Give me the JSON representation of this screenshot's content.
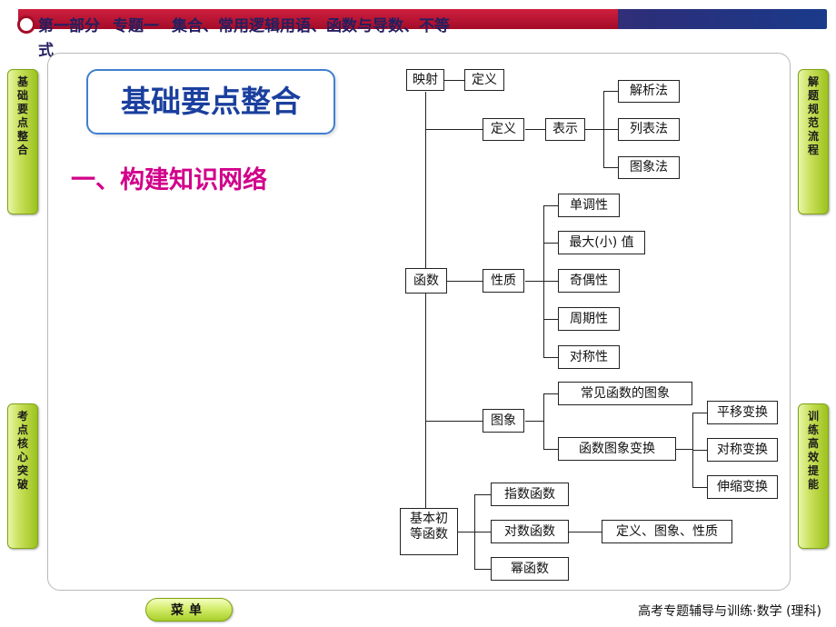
{
  "header": {
    "part": "第一部分",
    "topic": "专题一",
    "title": "集合、常用逻辑用语、函数与导数、不等",
    "title_line2": "式"
  },
  "side_tabs": {
    "left": [
      {
        "name": "basic-points-tab",
        "chars": [
          "基",
          "础",
          "要",
          "点",
          "整",
          "合"
        ]
      },
      {
        "name": "exam-points-tab",
        "chars": [
          "考",
          "点",
          "核",
          "心",
          "突",
          "破"
        ]
      }
    ],
    "right": [
      {
        "name": "solution-standard-tab",
        "chars": [
          "解",
          "题",
          "规",
          "范",
          "流",
          "程"
        ]
      },
      {
        "name": "training-tab",
        "chars": [
          "训",
          "练",
          "高",
          "效",
          "提",
          "能"
        ]
      }
    ]
  },
  "content": {
    "title": "基础要点整合",
    "subtitle": "一、构建知识网络"
  },
  "diagram": {
    "nodes": {
      "mapping": "映射",
      "mapping_def": "定义",
      "func_def": "定义",
      "represent": "表示",
      "analytic": "解析法",
      "table": "列表法",
      "graph_method": "图象法",
      "function": "函数",
      "property": "性质",
      "monotonic": "单调性",
      "maxmin": "最大(小) 值",
      "parity": "奇偶性",
      "periodic": "周期性",
      "symmetry": "对称性",
      "image": "图象",
      "common_graph": "常见函数的图象",
      "graph_transform": "函数图象变换",
      "translate": "平移变换",
      "symmetry_transform": "对称变换",
      "scale_transform": "伸缩变换",
      "basic_elem_l1": "基本初",
      "basic_elem_l2": "等函数",
      "exponential": "指数函数",
      "logarithm": "对数函数",
      "power": "幂函数",
      "def_graph_prop": "定义、图象、性质"
    }
  },
  "footer": {
    "menu": "菜单",
    "right_text": "高考专题辅导与训练·数学 (理科)"
  }
}
